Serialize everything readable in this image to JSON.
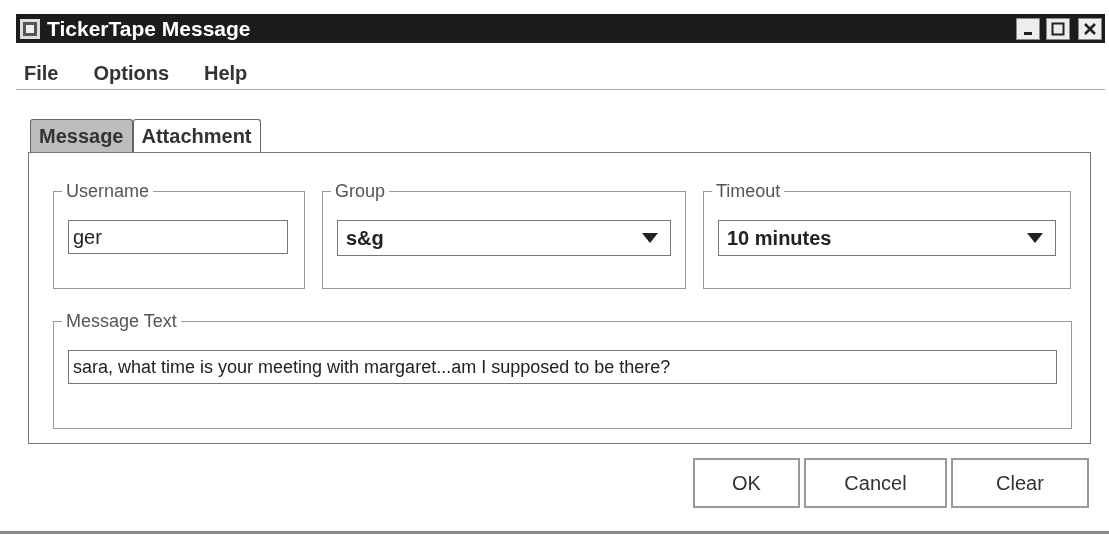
{
  "window": {
    "title": "TickerTape Message"
  },
  "menu": [
    {
      "label": "File"
    },
    {
      "label": "Options"
    },
    {
      "label": "Help"
    }
  ],
  "tabs": [
    {
      "label": "Message",
      "selected": true
    },
    {
      "label": "Attachment",
      "selected": false
    }
  ],
  "fields": [
    {
      "kind": "text",
      "label": "Username",
      "value": "ger"
    },
    {
      "kind": "combo",
      "label": "Group",
      "value": "s&g"
    },
    {
      "kind": "combo",
      "label": "Timeout",
      "value": "10 minutes"
    }
  ],
  "message": {
    "label": "Message Text",
    "value": "sara, what time is your meeting with margaret...am I supposed to be there?"
  },
  "buttons": [
    "OK",
    "Cancel",
    "Clear"
  ]
}
